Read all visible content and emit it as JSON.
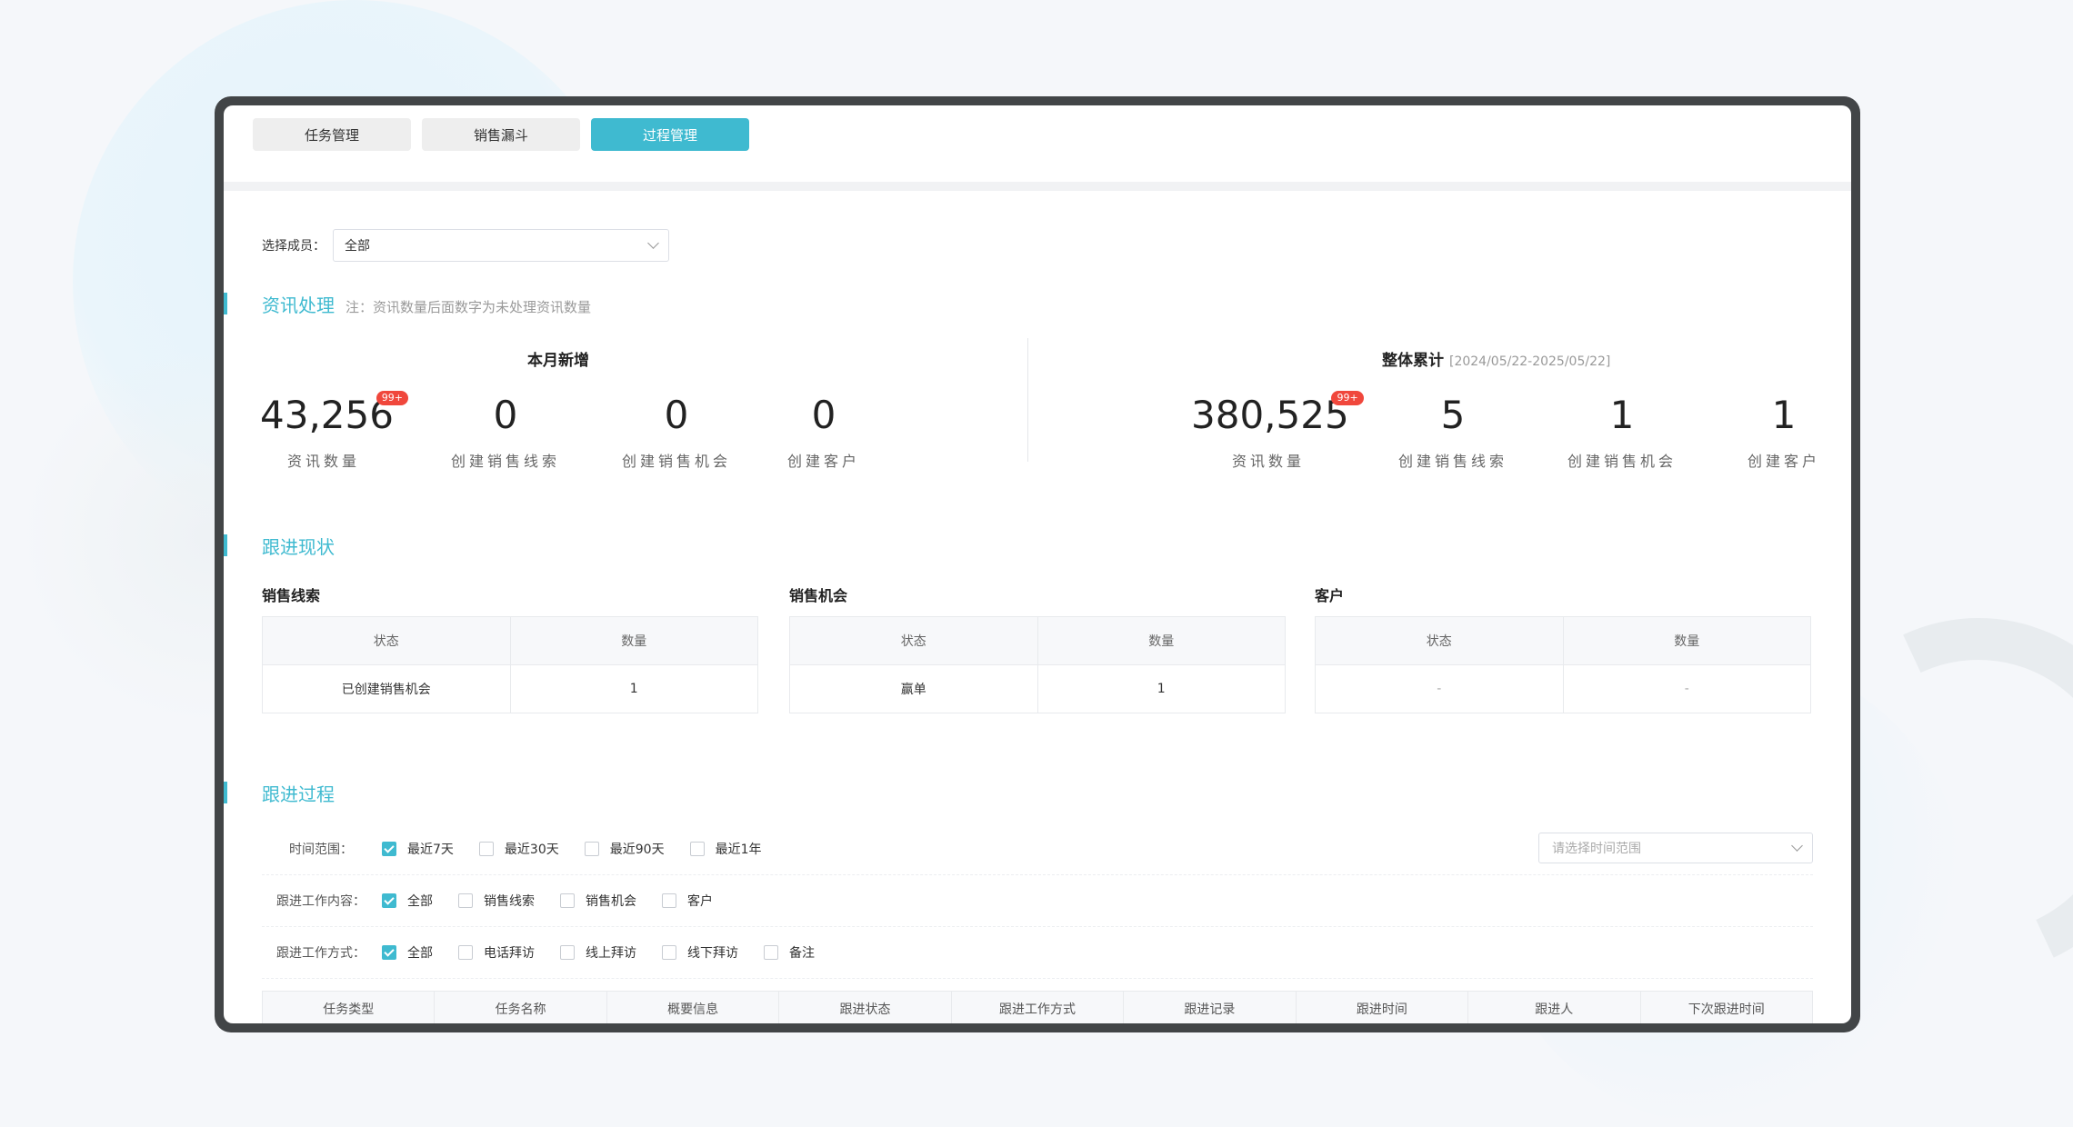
{
  "tabs": [
    {
      "label": "任务管理",
      "active": false
    },
    {
      "label": "销售漏斗",
      "active": false
    },
    {
      "label": "过程管理",
      "active": true
    }
  ],
  "member_filter": {
    "label": "选择成员：",
    "value": "全部"
  },
  "info_section": {
    "title": "资讯处理",
    "note": "注：资讯数量后面数字为未处理资讯数量",
    "monthly": {
      "heading": "本月新增",
      "stats": [
        {
          "value": "43,256",
          "label": "资讯数量",
          "badge": "99+"
        },
        {
          "value": "0",
          "label": "创建销售线索"
        },
        {
          "value": "0",
          "label": "创建销售机会"
        },
        {
          "value": "0",
          "label": "创建客户"
        }
      ]
    },
    "overall": {
      "heading": "整体累计",
      "range": "[2024/05/22-2025/05/22]",
      "stats": [
        {
          "value": "380,525",
          "label": "资讯数量",
          "badge": "99+"
        },
        {
          "value": "5",
          "label": "创建销售线索"
        },
        {
          "value": "1",
          "label": "创建销售机会"
        },
        {
          "value": "1",
          "label": "创建客户"
        }
      ]
    }
  },
  "status_section": {
    "title": "跟进现状",
    "tables": [
      {
        "title": "销售线索",
        "headers": [
          "状态",
          "数量"
        ],
        "rows": [
          [
            "已创建销售机会",
            "1"
          ]
        ]
      },
      {
        "title": "销售机会",
        "headers": [
          "状态",
          "数量"
        ],
        "rows": [
          [
            "赢单",
            "1"
          ]
        ]
      },
      {
        "title": "客户",
        "headers": [
          "状态",
          "数量"
        ],
        "rows": [
          [
            "-",
            "-"
          ]
        ]
      }
    ]
  },
  "process_section": {
    "title": "跟进过程",
    "time_range": {
      "label": "时间范围：",
      "options": [
        {
          "label": "最近7天",
          "checked": true
        },
        {
          "label": "最近30天",
          "checked": false
        },
        {
          "label": "最近90天",
          "checked": false
        },
        {
          "label": "最近1年",
          "checked": false
        }
      ],
      "date_placeholder": "请选择时间范围"
    },
    "content": {
      "label": "跟进工作内容：",
      "options": [
        {
          "label": "全部",
          "checked": true
        },
        {
          "label": "销售线索",
          "checked": false
        },
        {
          "label": "销售机会",
          "checked": false
        },
        {
          "label": "客户",
          "checked": false
        }
      ]
    },
    "method": {
      "label": "跟进工作方式：",
      "options": [
        {
          "label": "全部",
          "checked": true
        },
        {
          "label": "电话拜访",
          "checked": false
        },
        {
          "label": "线上拜访",
          "checked": false
        },
        {
          "label": "线下拜访",
          "checked": false
        },
        {
          "label": "备注",
          "checked": false
        }
      ]
    },
    "columns": [
      "任务类型",
      "任务名称",
      "概要信息",
      "跟进状态",
      "跟进工作方式",
      "跟进记录",
      "跟进时间",
      "跟进人",
      "下次跟进时间"
    ]
  },
  "colors": {
    "accent": "#3fbad0",
    "badge": "#f0473c",
    "frame": "#424547"
  }
}
